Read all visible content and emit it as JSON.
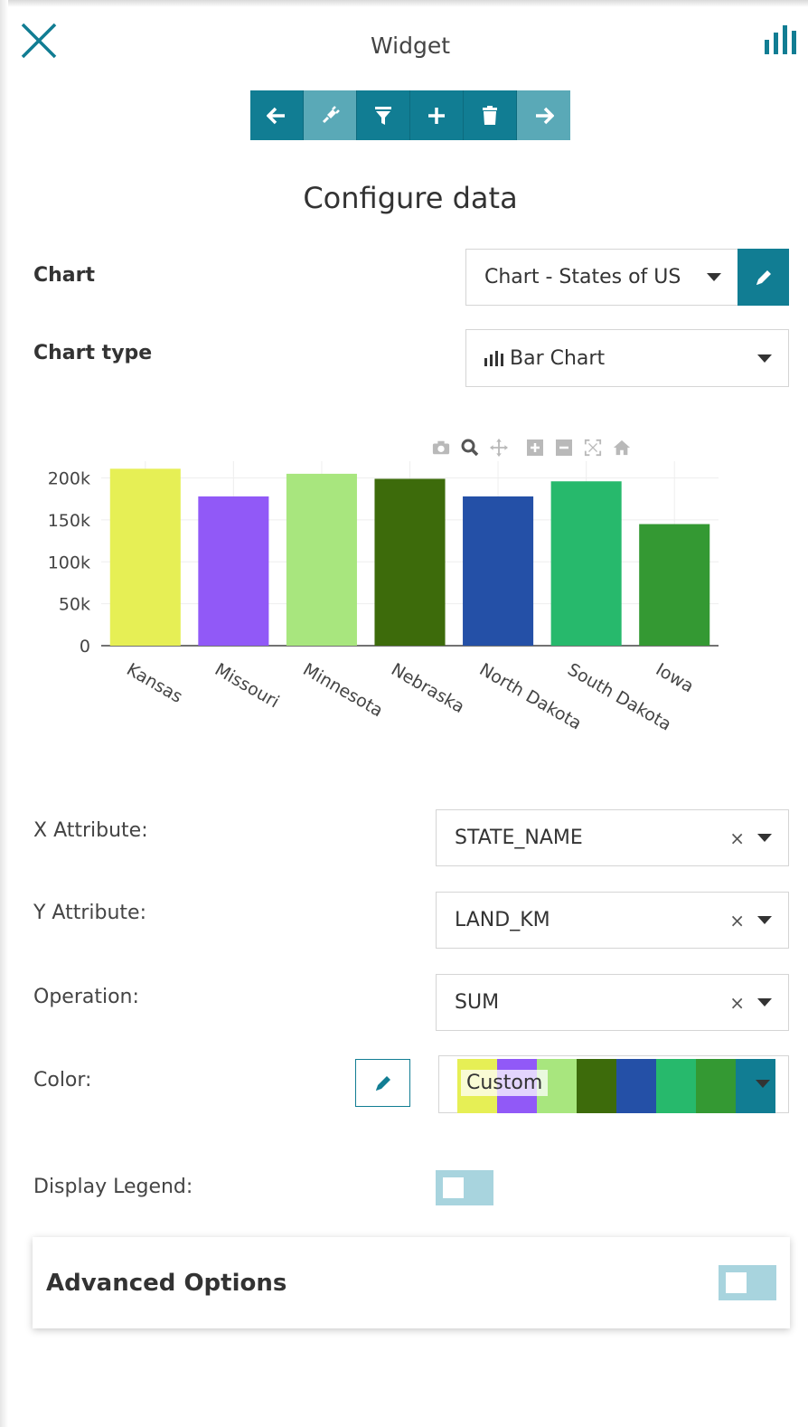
{
  "header": {
    "title": "Widget",
    "close_icon": "close-icon",
    "widget_type_icon": "bar-chart-icon"
  },
  "toolbar": {
    "buttons": [
      {
        "name": "back",
        "icon": "arrow-left-icon"
      },
      {
        "name": "connect",
        "icon": "plug-icon"
      },
      {
        "name": "filter",
        "icon": "filter-icon"
      },
      {
        "name": "add",
        "icon": "plus-icon"
      },
      {
        "name": "delete",
        "icon": "trash-icon"
      },
      {
        "name": "next",
        "icon": "arrow-right-icon"
      }
    ],
    "accent": "#117d93",
    "accent_light": "#5aa9b7"
  },
  "section_title": "Configure data",
  "chart_row": {
    "label": "Chart",
    "value": "Chart - States of US"
  },
  "chart_type_row": {
    "label": "Chart type",
    "value": "Bar Chart",
    "icon": "bar-chart-icon"
  },
  "modebar": [
    "camera-icon",
    "zoom-icon",
    "pan-icon",
    "zoom-in-icon",
    "zoom-out-icon",
    "autoscale-icon",
    "home-icon"
  ],
  "chart_data": {
    "type": "bar",
    "categories": [
      "Kansas",
      "Missouri",
      "Minnesota",
      "Nebraska",
      "North Dakota",
      "South Dakota",
      "Iowa"
    ],
    "values": [
      211000,
      178000,
      205000,
      199000,
      178000,
      196000,
      145000
    ],
    "colors": [
      "#e6ef55",
      "#9159f7",
      "#a8e67e",
      "#3d6b0b",
      "#2450a7",
      "#27b96c",
      "#349933"
    ],
    "ylim": [
      0,
      220000
    ],
    "yticks": [
      0,
      50000,
      100000,
      150000,
      200000
    ],
    "ytick_labels": [
      "0",
      "50k",
      "100k",
      "150k",
      "200k"
    ],
    "grid": true
  },
  "form": {
    "x_attribute": {
      "label": "X Attribute:",
      "value": "STATE_NAME"
    },
    "y_attribute": {
      "label": "Y Attribute:",
      "value": "LAND_KM"
    },
    "operation": {
      "label": "Operation:",
      "value": "SUM"
    },
    "color": {
      "label": "Color:",
      "value": "Custom",
      "swatches": [
        "#e6ef55",
        "#9159f7",
        "#a8e67e",
        "#3d6b0b",
        "#2450a7",
        "#27b96c",
        "#349933",
        "#117d93"
      ]
    },
    "display_legend": {
      "label": "Display Legend:",
      "on": false
    },
    "clear_symbol": "×"
  },
  "advanced": {
    "title": "Advanced Options",
    "on": false
  }
}
